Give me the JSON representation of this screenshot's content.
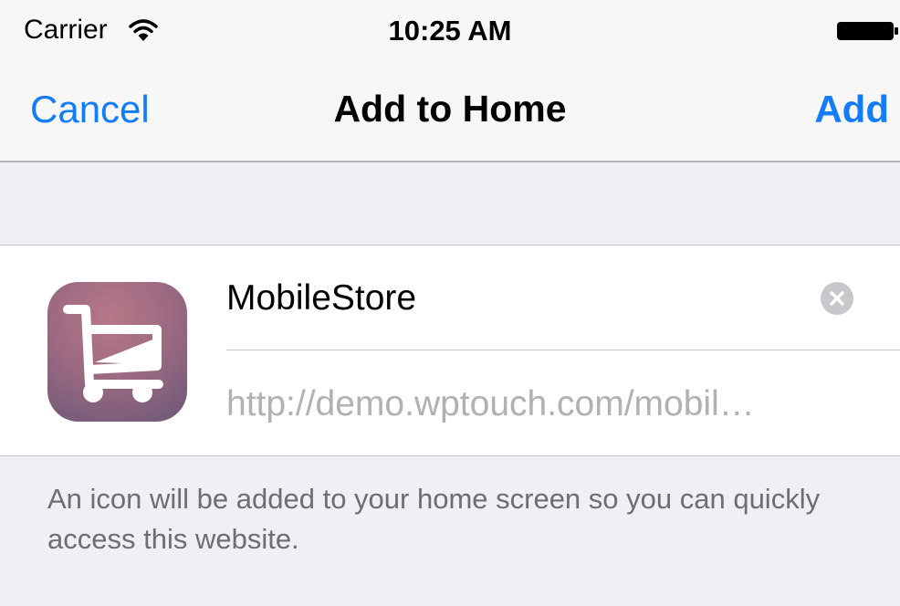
{
  "status_bar": {
    "carrier": "Carrier",
    "time": "10:25 AM",
    "wifi_icon": "wifi-icon",
    "battery_icon": "battery-icon"
  },
  "nav": {
    "cancel_label": "Cancel",
    "title": "Add to Home",
    "add_label": "Add",
    "accent_color": "#127CFD"
  },
  "form": {
    "app_icon": "shopping-cart-icon",
    "name_value": "MobileStore",
    "clear_icon": "clear-icon",
    "url": "http://demo.wptouch.com/mobil…"
  },
  "footer": {
    "note": "An icon will be added to your home screen so you can quickly access this website."
  }
}
